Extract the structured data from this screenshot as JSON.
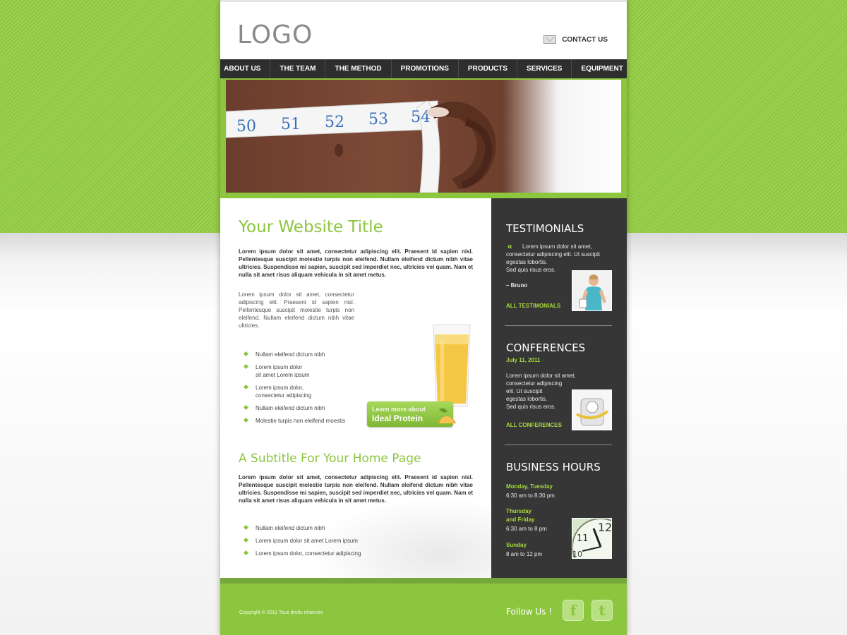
{
  "header": {
    "logo": "LOGO",
    "contact_label": "CONTACT US"
  },
  "nav": {
    "items": [
      "ABOUT US",
      "THE TEAM",
      "THE METHOD",
      "PROMOTIONS",
      "PRODUCTS",
      "SERVICES",
      "EQUIPMENT"
    ]
  },
  "hero": {
    "tape_numbers": [
      "50",
      "51",
      "52",
      "53",
      "54"
    ]
  },
  "main": {
    "title": "Your Website Title",
    "intro": "Lorem ipsum dolor sit amet, consectetur adipiscing elit. Praesent id sapien nisl. Pellentesque suscipit molestie turpis non eleifend. Nullam eleifend dictum nibh vitae ultricies. Suspendisse mi sapien, suscipit sed imperdiet nec, ultricies vel quam. Nam et nulla sit amet risus aliquam vehicula in sit amet metus.",
    "para2": "Lorem ipsum dolor sit amet, consectetur adipiscing elit. Praesent id sapien nisl. Pellentesque suscipit molestie turpis non eleifend. Nullam eleifend dictum nibh vitae ultricies.",
    "bullets1": [
      {
        "line1": "Nullam eleifend dictum nibh",
        "line2": ""
      },
      {
        "line1": "Lorem ipsum dolor",
        "line2": "sit amet Lorem ipsum"
      },
      {
        "line1": "Lorem ipsum dolor,",
        "line2": "consectetur adipiscing"
      },
      {
        "line1": "Nullam eleifend dictum nibh",
        "line2": ""
      },
      {
        "line1": "Molestie turpis non eleifend moestis",
        "line2": ""
      }
    ],
    "promo": {
      "small": "Learn more about",
      "big": "Ideal Protein"
    },
    "subtitle": "A Subtitle For Your Home Page",
    "para3": "Lorem ipsum dolor sit amet, consectetur adipiscing elit. Praesent id sapien nisl. Pellentesque suscipit molestie turpis non eleifend. Nullam eleifend dictum nibh vitae ultricies. Suspendisse mi sapien, suscipit sed imperdiet nec, ultricies vel quam. Nam et nulla sit amet risus aliquam vehicula in sit amet metus.",
    "bullets2": [
      "Nullam eleifend dictum nibh",
      "Lorem ipsum dolor sit amet Lorem ipsum",
      "Lorem ipsum dolor, consectetur adipiscing"
    ]
  },
  "sidebar": {
    "testimonials": {
      "heading": "TESTIMONIALS",
      "quote_mark": "«",
      "lines": [
        "Lorem ipsum dolor sit amet,",
        "consectetur adipiscing elit. Ut suscipit",
        "egestas lobortis.",
        "Sed quis risus eros."
      ],
      "author": "– Bruno",
      "link": "ALL TESTIMONIALS"
    },
    "conferences": {
      "heading": "CONFERENCES",
      "date": "July 11, 2011",
      "lines": [
        "Lorem ipsum dolor sit amet,",
        "consectetur adipiscing",
        "elit. Ut suscipit",
        "egestas lobortis.",
        "Sed quis risus eros."
      ],
      "link": "ALL CONFERENCES"
    },
    "hours": {
      "heading": "BUSINESS HOURS",
      "day1": "Monday, Tuesday",
      "time1": "6:30 am to 8:30 pm",
      "day2a": "Thursday",
      "day2b": "and Friday",
      "time2": "6:30 am to 8 pm",
      "day3": "Sunday",
      "time3": "8 am to 12 pm"
    }
  },
  "footer": {
    "copyright": "Copyright © 2011 Tous droits réservés",
    "follow": "Follow Us !",
    "facebook_glyph": "f",
    "twitter_glyph": "t"
  },
  "colors": {
    "accent": "#8cc63f",
    "accent_light": "#a6d93f",
    "dark": "#363636",
    "nav": "#2e2e2e"
  },
  "icons": [
    "mail-icon",
    "quote-icon",
    "facebook-icon",
    "twitter-icon",
    "bullet-diamond-icon"
  ]
}
